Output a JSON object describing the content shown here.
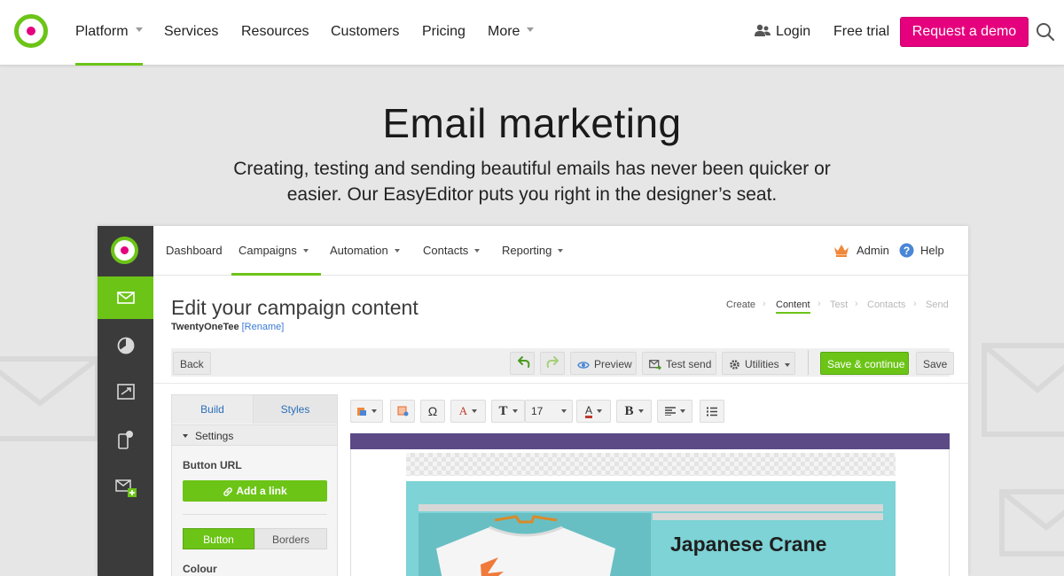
{
  "site_nav": {
    "items": [
      {
        "label": "Platform",
        "has_dropdown": true,
        "active": true
      },
      {
        "label": "Services",
        "has_dropdown": false
      },
      {
        "label": "Resources",
        "has_dropdown": false
      },
      {
        "label": "Customers",
        "has_dropdown": false
      },
      {
        "label": "Pricing",
        "has_dropdown": false
      },
      {
        "label": "More",
        "has_dropdown": true
      }
    ],
    "login_label": "Login",
    "free_trial_label": "Free trial",
    "demo_label": "Request a demo",
    "login_icon": "users-icon",
    "search_icon": "search-icon"
  },
  "hero": {
    "title": "Email marketing",
    "subtitle": "Creating, testing and sending beautiful emails has never been quicker or easier. Our EasyEditor puts you right in the designer’s seat."
  },
  "app": {
    "sidebar_icons": [
      "email-icon",
      "pie-chart-icon",
      "automation-icon",
      "mobile-icon",
      "add-email-icon"
    ],
    "active_sidebar_index": 0,
    "tabs": [
      {
        "label": "Dashboard",
        "has_dropdown": false
      },
      {
        "label": "Campaigns",
        "has_dropdown": true,
        "active": true
      },
      {
        "label": "Automation",
        "has_dropdown": true
      },
      {
        "label": "Contacts",
        "has_dropdown": true
      },
      {
        "label": "Reporting",
        "has_dropdown": true
      }
    ],
    "admin_label": "Admin",
    "help_label": "Help",
    "page_title": "Edit your campaign content",
    "campaign_name": "TwentyOneTee",
    "rename_label": "[Rename]",
    "steps": [
      "Create",
      "Content",
      "Test",
      "Contacts",
      "Send"
    ],
    "current_step": "Content",
    "toolbar": {
      "back": "Back",
      "preview": "Preview",
      "test_send": "Test send",
      "utilities": "Utilities",
      "save_continue": "Save & continue",
      "save": "Save"
    },
    "panel": {
      "tabs": [
        "Build",
        "Styles"
      ],
      "settings_label": "Settings",
      "button_url_label": "Button URL",
      "add_link_label": "Add a link",
      "segments": [
        "Button",
        "Borders"
      ],
      "colour_label": "Colour"
    },
    "editor": {
      "font_size": "17",
      "colors": {
        "accent": "#6cc417",
        "header_bar": "#5b4a86",
        "teal": "#7dd3d6"
      }
    },
    "email_preview": {
      "product_title": "Japanese Crane"
    }
  },
  "colors": {
    "brand_green": "#6cc417",
    "brand_pink": "#e5007d",
    "sidebar_dark": "#3b3b3b"
  }
}
